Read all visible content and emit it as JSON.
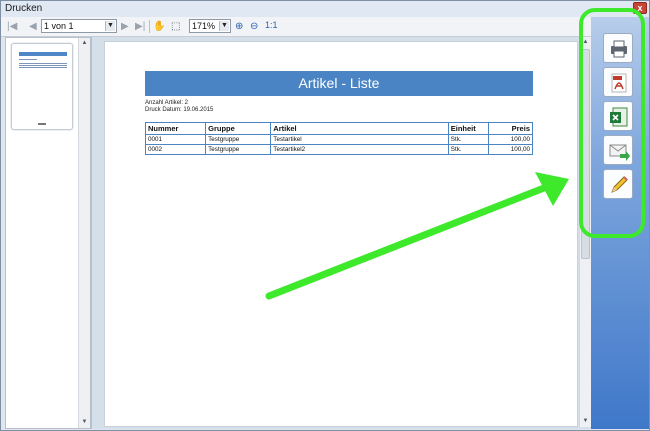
{
  "window": {
    "title": "Drucken",
    "close_label": "x"
  },
  "toolbar": {
    "page_value": "1 von 1",
    "zoom_value": "171%",
    "actual_size_label": "1:1"
  },
  "report": {
    "title": "Artikel - Liste",
    "count_text": "Anzahl Artikel: 2",
    "date_text": "Druck Datum: 19.06.2015",
    "columns": [
      "Nummer",
      "Gruppe",
      "Artikel",
      "Einheit",
      "Preis"
    ],
    "rows": [
      [
        "0001",
        "Testgruppe",
        "Testartikel",
        "Stk.",
        "100,00"
      ],
      [
        "0002",
        "Testgruppe",
        "Testartikel2",
        "Stk.",
        "100,00"
      ]
    ]
  },
  "side_actions": [
    {
      "name": "print-icon"
    },
    {
      "name": "pdf-icon"
    },
    {
      "name": "excel-icon"
    },
    {
      "name": "email-icon"
    },
    {
      "name": "edit-icon"
    }
  ],
  "colors": {
    "accent": "#4a84c4",
    "highlight": "#3ee82b"
  }
}
